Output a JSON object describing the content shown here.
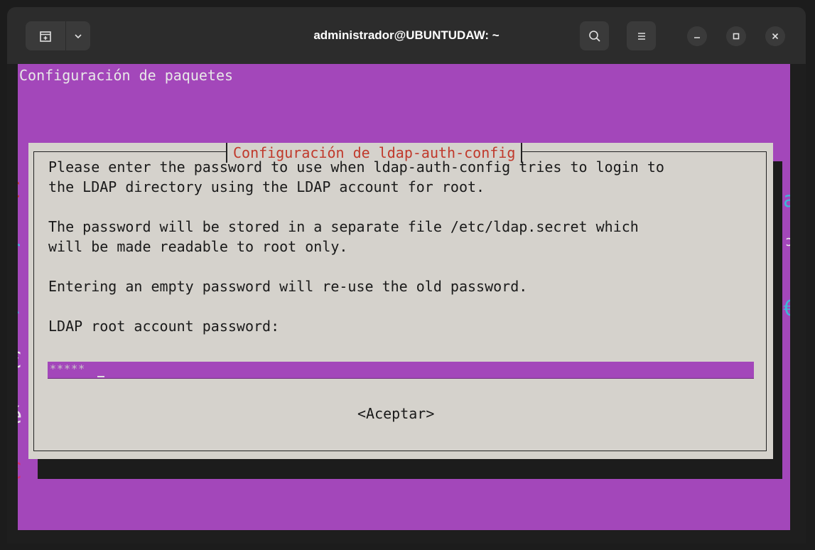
{
  "window": {
    "title": "administrador@UBUNTUDAW: ~"
  },
  "titlebar_icons": {
    "new_tab": "new-tab-icon",
    "dropdown": "chevron-down-icon",
    "search": "search-icon",
    "menu": "hamburger-menu-icon",
    "minimize": "minimize-icon",
    "maximize": "maximize-icon",
    "close": "close-icon"
  },
  "terminal": {
    "header": "Configuración de paquetes",
    "background_color": "#a347ba"
  },
  "dialog": {
    "title": "Configuración de ldap-auth-config",
    "lines": [
      "Please enter the password to use when ldap-auth-config tries to login to",
      "the LDAP directory using the LDAP account for root.",
      "",
      "The password will be stored in a separate file /etc/ldap.secret which",
      "will be made readable to root only.",
      "",
      "Entering an empty password will re-use the old password.",
      "",
      "LDAP root account password:"
    ],
    "password_value": "*****",
    "ok_button": "<Aceptar>"
  },
  "edge_glyphs": {
    "left": [
      "C",
      "r",
      "\\",
      "€",
      "é",
      "€"
    ],
    "right": [
      "a",
      "ɔ",
      "€"
    ]
  }
}
